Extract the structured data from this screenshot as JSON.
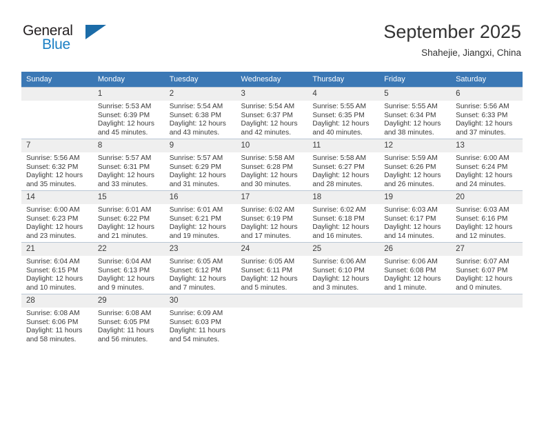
{
  "logo": {
    "word_top": "General",
    "word_bottom": "Blue",
    "triangle_icon": "blue-triangle-icon",
    "color_dark": "#231f20",
    "color_blue": "#1b7fc4"
  },
  "header": {
    "title": "September 2025",
    "subtitle": "Shahejie, Jiangxi, China"
  },
  "theme": {
    "header_row_bg": "#3b78b5",
    "daynum_bg": "#efefef",
    "grid_line": "#b9c6d4",
    "text": "#3a3a3a"
  },
  "calendar": {
    "weekday_headers": [
      "Sunday",
      "Monday",
      "Tuesday",
      "Wednesday",
      "Thursday",
      "Friday",
      "Saturday"
    ],
    "weeks": [
      [
        {
          "day": "",
          "sunrise": "",
          "sunset": "",
          "daylight_line1": "",
          "daylight_line2": ""
        },
        {
          "day": "1",
          "sunrise": "Sunrise: 5:53 AM",
          "sunset": "Sunset: 6:39 PM",
          "daylight_line1": "Daylight: 12 hours",
          "daylight_line2": "and 45 minutes."
        },
        {
          "day": "2",
          "sunrise": "Sunrise: 5:54 AM",
          "sunset": "Sunset: 6:38 PM",
          "daylight_line1": "Daylight: 12 hours",
          "daylight_line2": "and 43 minutes."
        },
        {
          "day": "3",
          "sunrise": "Sunrise: 5:54 AM",
          "sunset": "Sunset: 6:37 PM",
          "daylight_line1": "Daylight: 12 hours",
          "daylight_line2": "and 42 minutes."
        },
        {
          "day": "4",
          "sunrise": "Sunrise: 5:55 AM",
          "sunset": "Sunset: 6:35 PM",
          "daylight_line1": "Daylight: 12 hours",
          "daylight_line2": "and 40 minutes."
        },
        {
          "day": "5",
          "sunrise": "Sunrise: 5:55 AM",
          "sunset": "Sunset: 6:34 PM",
          "daylight_line1": "Daylight: 12 hours",
          "daylight_line2": "and 38 minutes."
        },
        {
          "day": "6",
          "sunrise": "Sunrise: 5:56 AM",
          "sunset": "Sunset: 6:33 PM",
          "daylight_line1": "Daylight: 12 hours",
          "daylight_line2": "and 37 minutes."
        }
      ],
      [
        {
          "day": "7",
          "sunrise": "Sunrise: 5:56 AM",
          "sunset": "Sunset: 6:32 PM",
          "daylight_line1": "Daylight: 12 hours",
          "daylight_line2": "and 35 minutes."
        },
        {
          "day": "8",
          "sunrise": "Sunrise: 5:57 AM",
          "sunset": "Sunset: 6:31 PM",
          "daylight_line1": "Daylight: 12 hours",
          "daylight_line2": "and 33 minutes."
        },
        {
          "day": "9",
          "sunrise": "Sunrise: 5:57 AM",
          "sunset": "Sunset: 6:29 PM",
          "daylight_line1": "Daylight: 12 hours",
          "daylight_line2": "and 31 minutes."
        },
        {
          "day": "10",
          "sunrise": "Sunrise: 5:58 AM",
          "sunset": "Sunset: 6:28 PM",
          "daylight_line1": "Daylight: 12 hours",
          "daylight_line2": "and 30 minutes."
        },
        {
          "day": "11",
          "sunrise": "Sunrise: 5:58 AM",
          "sunset": "Sunset: 6:27 PM",
          "daylight_line1": "Daylight: 12 hours",
          "daylight_line2": "and 28 minutes."
        },
        {
          "day": "12",
          "sunrise": "Sunrise: 5:59 AM",
          "sunset": "Sunset: 6:26 PM",
          "daylight_line1": "Daylight: 12 hours",
          "daylight_line2": "and 26 minutes."
        },
        {
          "day": "13",
          "sunrise": "Sunrise: 6:00 AM",
          "sunset": "Sunset: 6:24 PM",
          "daylight_line1": "Daylight: 12 hours",
          "daylight_line2": "and 24 minutes."
        }
      ],
      [
        {
          "day": "14",
          "sunrise": "Sunrise: 6:00 AM",
          "sunset": "Sunset: 6:23 PM",
          "daylight_line1": "Daylight: 12 hours",
          "daylight_line2": "and 23 minutes."
        },
        {
          "day": "15",
          "sunrise": "Sunrise: 6:01 AM",
          "sunset": "Sunset: 6:22 PM",
          "daylight_line1": "Daylight: 12 hours",
          "daylight_line2": "and 21 minutes."
        },
        {
          "day": "16",
          "sunrise": "Sunrise: 6:01 AM",
          "sunset": "Sunset: 6:21 PM",
          "daylight_line1": "Daylight: 12 hours",
          "daylight_line2": "and 19 minutes."
        },
        {
          "day": "17",
          "sunrise": "Sunrise: 6:02 AM",
          "sunset": "Sunset: 6:19 PM",
          "daylight_line1": "Daylight: 12 hours",
          "daylight_line2": "and 17 minutes."
        },
        {
          "day": "18",
          "sunrise": "Sunrise: 6:02 AM",
          "sunset": "Sunset: 6:18 PM",
          "daylight_line1": "Daylight: 12 hours",
          "daylight_line2": "and 16 minutes."
        },
        {
          "day": "19",
          "sunrise": "Sunrise: 6:03 AM",
          "sunset": "Sunset: 6:17 PM",
          "daylight_line1": "Daylight: 12 hours",
          "daylight_line2": "and 14 minutes."
        },
        {
          "day": "20",
          "sunrise": "Sunrise: 6:03 AM",
          "sunset": "Sunset: 6:16 PM",
          "daylight_line1": "Daylight: 12 hours",
          "daylight_line2": "and 12 minutes."
        }
      ],
      [
        {
          "day": "21",
          "sunrise": "Sunrise: 6:04 AM",
          "sunset": "Sunset: 6:15 PM",
          "daylight_line1": "Daylight: 12 hours",
          "daylight_line2": "and 10 minutes."
        },
        {
          "day": "22",
          "sunrise": "Sunrise: 6:04 AM",
          "sunset": "Sunset: 6:13 PM",
          "daylight_line1": "Daylight: 12 hours",
          "daylight_line2": "and 9 minutes."
        },
        {
          "day": "23",
          "sunrise": "Sunrise: 6:05 AM",
          "sunset": "Sunset: 6:12 PM",
          "daylight_line1": "Daylight: 12 hours",
          "daylight_line2": "and 7 minutes."
        },
        {
          "day": "24",
          "sunrise": "Sunrise: 6:05 AM",
          "sunset": "Sunset: 6:11 PM",
          "daylight_line1": "Daylight: 12 hours",
          "daylight_line2": "and 5 minutes."
        },
        {
          "day": "25",
          "sunrise": "Sunrise: 6:06 AM",
          "sunset": "Sunset: 6:10 PM",
          "daylight_line1": "Daylight: 12 hours",
          "daylight_line2": "and 3 minutes."
        },
        {
          "day": "26",
          "sunrise": "Sunrise: 6:06 AM",
          "sunset": "Sunset: 6:08 PM",
          "daylight_line1": "Daylight: 12 hours",
          "daylight_line2": "and 1 minute."
        },
        {
          "day": "27",
          "sunrise": "Sunrise: 6:07 AM",
          "sunset": "Sunset: 6:07 PM",
          "daylight_line1": "Daylight: 12 hours",
          "daylight_line2": "and 0 minutes."
        }
      ],
      [
        {
          "day": "28",
          "sunrise": "Sunrise: 6:08 AM",
          "sunset": "Sunset: 6:06 PM",
          "daylight_line1": "Daylight: 11 hours",
          "daylight_line2": "and 58 minutes."
        },
        {
          "day": "29",
          "sunrise": "Sunrise: 6:08 AM",
          "sunset": "Sunset: 6:05 PM",
          "daylight_line1": "Daylight: 11 hours",
          "daylight_line2": "and 56 minutes."
        },
        {
          "day": "30",
          "sunrise": "Sunrise: 6:09 AM",
          "sunset": "Sunset: 6:03 PM",
          "daylight_line1": "Daylight: 11 hours",
          "daylight_line2": "and 54 minutes."
        },
        {
          "day": "",
          "sunrise": "",
          "sunset": "",
          "daylight_line1": "",
          "daylight_line2": ""
        },
        {
          "day": "",
          "sunrise": "",
          "sunset": "",
          "daylight_line1": "",
          "daylight_line2": ""
        },
        {
          "day": "",
          "sunrise": "",
          "sunset": "",
          "daylight_line1": "",
          "daylight_line2": ""
        },
        {
          "day": "",
          "sunrise": "",
          "sunset": "",
          "daylight_line1": "",
          "daylight_line2": ""
        }
      ]
    ]
  }
}
